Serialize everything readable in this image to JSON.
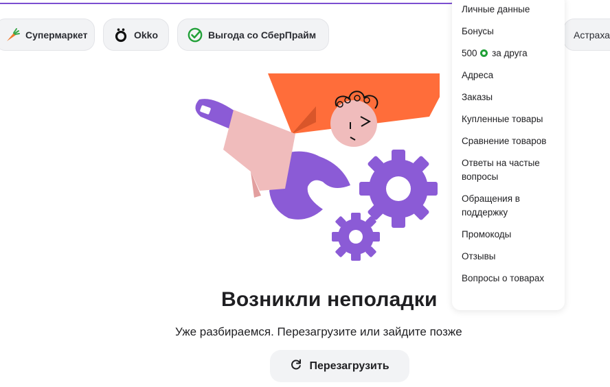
{
  "category_chips": [
    {
      "label": "Супермаркет",
      "icon": "carrot-icon"
    },
    {
      "label": "Okko",
      "icon": "okko-icon"
    },
    {
      "label": "Выгода со СберПрайм",
      "icon": "sberprime-check-icon"
    },
    {
      "label": "Астраха"
    }
  ],
  "error": {
    "title": "Возникли неполадки",
    "subtitle": "Уже разбираемся. Перезагрузите или зайдите позже",
    "reload_label": "Перезагрузить",
    "reload_icon": "reload-icon"
  },
  "account_menu": {
    "items": [
      {
        "label": "Личные данные"
      },
      {
        "label": "Бонусы"
      },
      {
        "label_prefix": "500",
        "label_suffix": "за друга",
        "icon": "sber-bonus-icon"
      },
      {
        "label": "Адреса"
      },
      {
        "label": "Заказы"
      },
      {
        "label": "Купленные товары"
      },
      {
        "label": "Сравнение товаров"
      },
      {
        "label": "Ответы на частые вопросы"
      },
      {
        "label": "Обращения в поддержку"
      },
      {
        "label": "Промокоды"
      },
      {
        "label": "Отзывы"
      },
      {
        "label": "Вопросы о товарах"
      }
    ]
  },
  "colors": {
    "accent_purple": "#7b4ed0",
    "sber_green": "#21a038",
    "chip_bg": "#f2f3f5",
    "illustration_orange": "#ff6d3a",
    "illustration_purple": "#8b5bd6",
    "illustration_pink": "#f0bcbc"
  }
}
